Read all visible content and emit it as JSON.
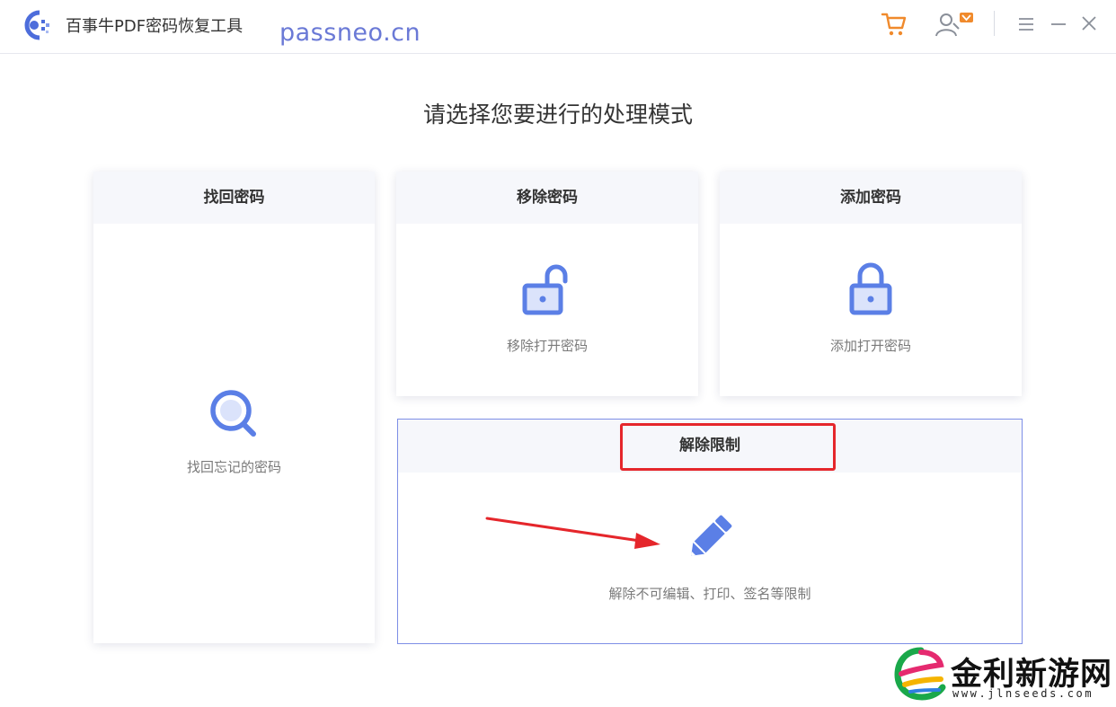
{
  "app": {
    "title": "百事牛PDF密码恢复工具",
    "watermark_url": "passneo.cn"
  },
  "titlebar_icons": [
    "cart-icon",
    "user-vip-icon",
    "menu-icon",
    "minimize-icon",
    "close-icon"
  ],
  "main": {
    "heading": "请选择您要进行的处理模式",
    "cards": [
      {
        "title": "找回密码",
        "icon": "search-icon",
        "description": "找回忘记的密码"
      },
      {
        "title": "移除密码",
        "icon": "unlock-icon",
        "description": "移除打开密码"
      },
      {
        "title": "添加密码",
        "icon": "lock-icon",
        "description": "添加打开密码"
      },
      {
        "title": "解除限制",
        "icon": "pencil-icon",
        "description": "解除不可编辑、打印、签名等限制"
      }
    ]
  },
  "watermark": {
    "site_name": "金利新游网",
    "site_url": "www.jlnseeds.com"
  },
  "colors": {
    "accent": "#5b7fe6",
    "cart": "#f08a2c",
    "highlight": "#e5262b",
    "card_border_selected": "#7d8ee6"
  }
}
